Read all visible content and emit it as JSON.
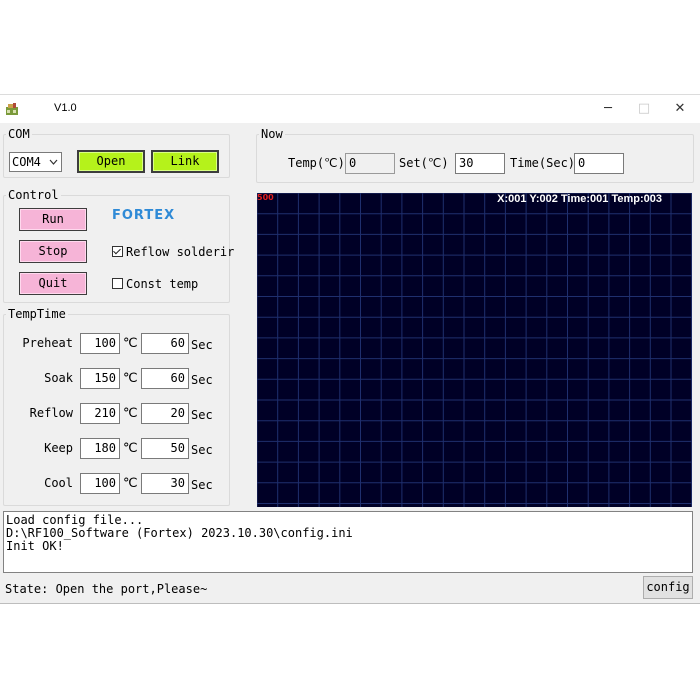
{
  "window": {
    "title": "V1.0",
    "controls": {
      "minimize": "─",
      "maximize": "□",
      "close": "✕"
    }
  },
  "com": {
    "group_label": "COM",
    "port": "COM4",
    "open_label": "Open",
    "link_label": "Link"
  },
  "now": {
    "group_label": "Now",
    "temp_label": "Temp(℃)",
    "temp_value": "0",
    "set_label": "Set(℃)",
    "set_value": "30",
    "time_label": "Time(Sec)",
    "time_value": "0"
  },
  "control": {
    "group_label": "Control",
    "run_label": "Run",
    "stop_label": "Stop",
    "quit_label": "Quit",
    "logo_text": "FORTEX",
    "reflow_label": "Reflow solderir",
    "reflow_checked": true,
    "const_label": "Const temp",
    "const_checked": false
  },
  "temptime": {
    "group_label": "TempTime",
    "rows": [
      {
        "label": "Preheat",
        "temp": "100",
        "temp_unit": "℃",
        "time": "60",
        "time_unit": "Sec"
      },
      {
        "label": "Soak",
        "temp": "150",
        "temp_unit": "℃",
        "time": "60",
        "time_unit": "Sec"
      },
      {
        "label": "Reflow",
        "temp": "210",
        "temp_unit": "℃",
        "time": "20",
        "time_unit": "Sec"
      },
      {
        "label": "Keep",
        "temp": "180",
        "temp_unit": "℃",
        "time": "50",
        "time_unit": "Sec"
      },
      {
        "label": "Cool",
        "temp": "100",
        "temp_unit": "℃",
        "time": "30",
        "time_unit": "Sec"
      }
    ]
  },
  "chart": {
    "y_max_label": "500",
    "readout": "X:001 Y:002 Time:001 Temp:003",
    "background": "#000026",
    "grid_color": "#1f2f6e"
  },
  "log": {
    "lines": [
      "Load config file...",
      "D:\\RF100_Software (Fortex) 2023.10.30\\config.ini",
      "Init OK!"
    ]
  },
  "status": {
    "text": "State: Open the port,Please~",
    "config_label": "config"
  },
  "colors": {
    "green_button": "#b5f21b",
    "pink_button": "#f6b4d7",
    "logo": "#2f8ad6"
  }
}
